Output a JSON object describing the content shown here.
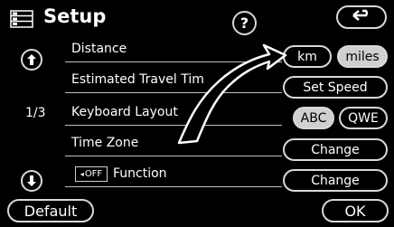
{
  "header": {
    "title": "Setup",
    "help_label": "?",
    "back_icon": "return-arrow-icon",
    "menu_icon": "menu-list-icon"
  },
  "pager": {
    "page": "1/3",
    "up_icon": "scroll-up-icon",
    "down_icon": "scroll-down-icon"
  },
  "rows": [
    {
      "label": "Distance",
      "options": [
        "km",
        "miles"
      ],
      "selected": "miles"
    },
    {
      "label": "Estimated Travel Tim",
      "button": "Set Speed"
    },
    {
      "label": "Keyboard Layout",
      "options": [
        "ABC",
        "QWE"
      ],
      "selected": "ABC"
    },
    {
      "label": "Time Zone",
      "button": "Change"
    },
    {
      "label": "Function",
      "badge": "OFF",
      "badge_icon": "speaker-icon",
      "button": "Change"
    }
  ],
  "footer": {
    "default_label": "Default",
    "ok_label": "OK"
  },
  "overlay": {
    "pointer_icon": "curved-arrow-icon"
  }
}
